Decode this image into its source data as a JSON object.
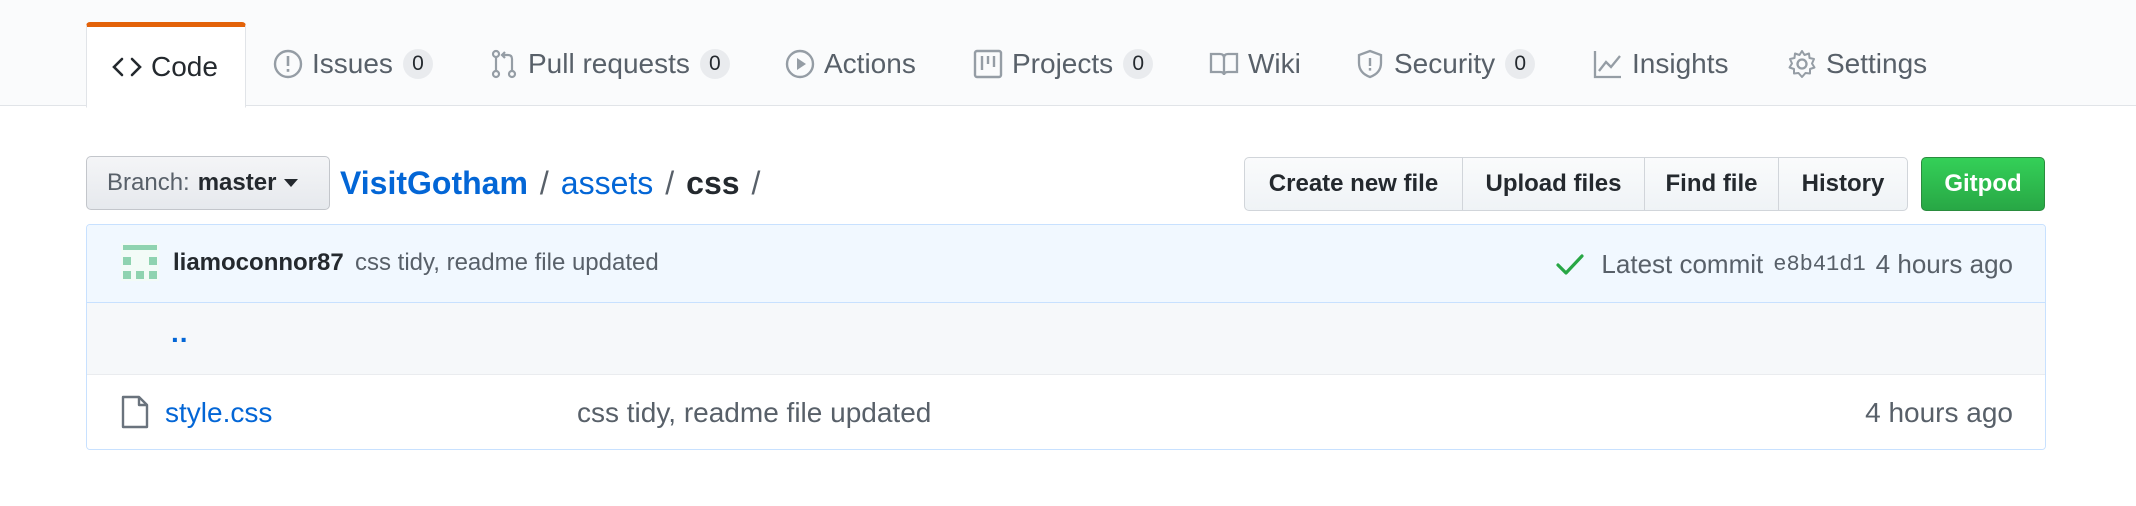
{
  "tabs": [
    {
      "label": "Code",
      "icon": "code-icon",
      "selected": true
    },
    {
      "label": "Issues",
      "icon": "issue-opened-icon",
      "count": "0"
    },
    {
      "label": "Pull requests",
      "icon": "git-pull-request-icon",
      "count": "0"
    },
    {
      "label": "Actions",
      "icon": "play-icon"
    },
    {
      "label": "Projects",
      "icon": "project-icon",
      "count": "0"
    },
    {
      "label": "Wiki",
      "icon": "book-icon"
    },
    {
      "label": "Security",
      "icon": "shield-icon",
      "count": "0"
    },
    {
      "label": "Insights",
      "icon": "graph-icon"
    },
    {
      "label": "Settings",
      "icon": "gear-icon"
    }
  ],
  "branch": {
    "prefix": "Branch:",
    "name": "master"
  },
  "breadcrumb": {
    "repo": "VisitGotham",
    "sep1": "/",
    "folder": "assets",
    "sep2": "/",
    "current": "css",
    "sep3": "/"
  },
  "actions": {
    "create_new_file": "Create new file",
    "upload_files": "Upload files",
    "find_file": "Find file",
    "history": "History",
    "gitpod": "Gitpod"
  },
  "commit": {
    "author": "liamoconnor87",
    "message": "css tidy, readme file updated",
    "latest_label": "Latest commit",
    "sha": "e8b41d1",
    "age": "4 hours ago"
  },
  "parent_link": "..",
  "files": [
    {
      "name": "style.css",
      "message": "css tidy, readme file updated",
      "age": "4 hours ago"
    }
  ],
  "colors": {
    "accent": "#e36209",
    "link": "#0366d6",
    "gitpod": "#28a745",
    "commit_bg": "#f1f8ff"
  }
}
